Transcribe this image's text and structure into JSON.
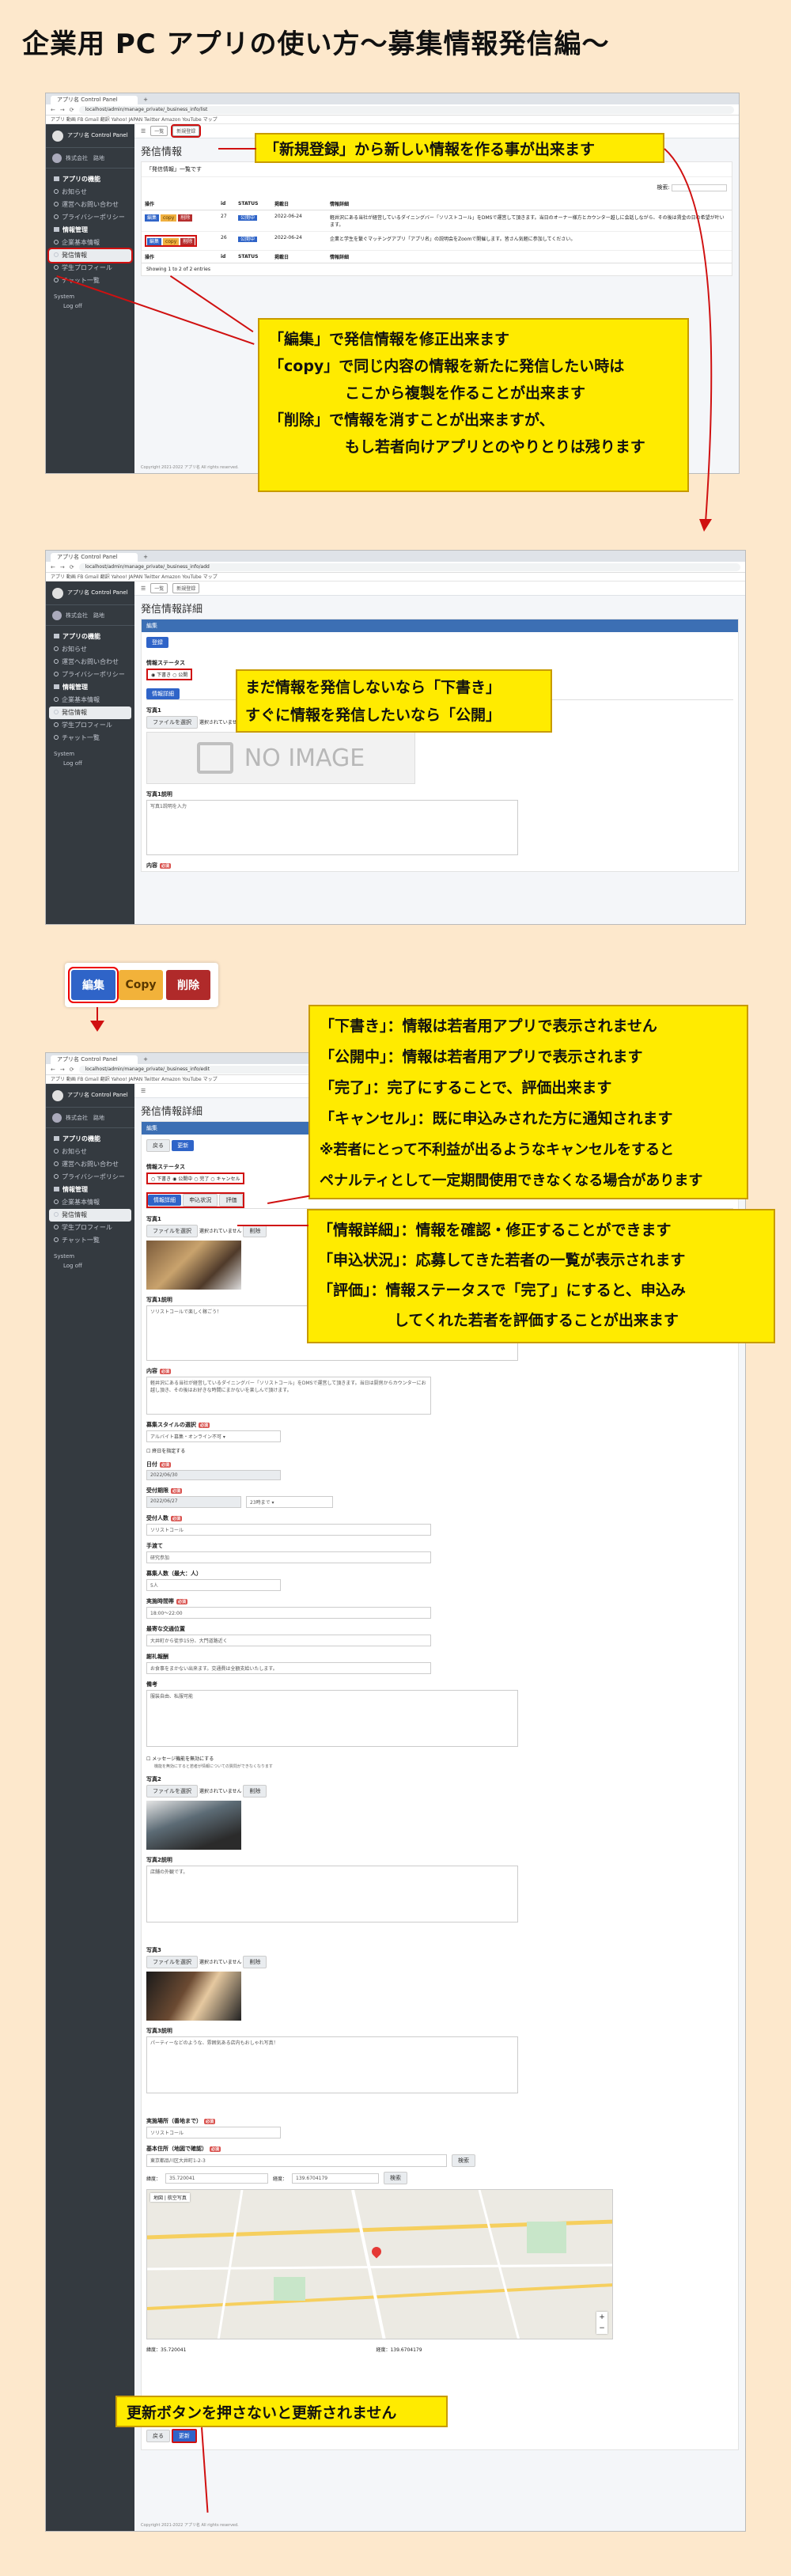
{
  "title": "企業用 PC アプリの使い方〜募集情報発信編〜",
  "browser": {
    "tab_label": "アプリ名 Control Panel",
    "url1": "localhost/admin/manage_private/_business_info/list",
    "url2": "localhost/admin/manage_private/_business_info/add",
    "url3": "localhost/admin/manage_private/_business_info/edit",
    "bookmarks": "アプリ  動画  FB  Gmail  翻訳  Yahoo! JAPAN  Twitter  Amazon  YouTube  マップ"
  },
  "sidebar": {
    "brand": "アプリ名 Control Panel",
    "company": "株式会社　路地",
    "items": [
      {
        "label": "アプリの機能",
        "type": "head"
      },
      {
        "label": "お知らせ",
        "type": "item"
      },
      {
        "label": "運営へお問い合わせ",
        "type": "item"
      },
      {
        "label": "プライバシーポリシー",
        "type": "item"
      },
      {
        "label": "情報管理",
        "type": "head"
      },
      {
        "label": "企業基本情報",
        "type": "item"
      },
      {
        "label": "発信情報",
        "type": "item",
        "active": true
      },
      {
        "label": "学生プロフィール",
        "type": "item"
      },
      {
        "label": "チャット一覧",
        "type": "item"
      }
    ],
    "system_label": "System",
    "logout": "Log off"
  },
  "screen1": {
    "nav_list": "一覧",
    "nav_new": "新規登録",
    "heading": "発信情報",
    "card_caption": "「発信情報」一覧です",
    "search_label": "検索:",
    "columns": [
      "操作",
      "id",
      "STATUS",
      "掲載日",
      "情報詳細"
    ],
    "rows": [
      {
        "id": "27",
        "status": "公開中",
        "date": "2022-06-24",
        "detail": "軽井沢にある当社が経営しているダイニングバー「ソリストコール」をDMSで運営して頂きます。当日のオーナー様方とカウンター越しに会話しながら、その後は賃金の日の希望が叶います。"
      },
      {
        "id": "26",
        "status": "公開中",
        "date": "2022-06-24",
        "detail": "企業と学生を繋ぐマッチングアプリ「アプリ名」の説明会をZoomで開催します。皆さん気軽に参加してください。"
      }
    ],
    "row_buttons": {
      "edit": "編集",
      "copy": "copy",
      "delete": "削除"
    },
    "footer_info": "Showing 1 to 2 of 2 entries",
    "copyright": "Copyright 2021-2022 アプリ名 All rights reserved."
  },
  "screen2": {
    "nav_list": "一覧",
    "nav_new": "新規登録",
    "heading": "発信情報詳細",
    "card_header": "編集",
    "save_btn": "登録",
    "status_label": "情報ステータス",
    "status_options": [
      "下書き",
      "公開"
    ],
    "tab_detail": "情報詳細",
    "image1_label": "写真1",
    "file_btn": "ファイルを選択",
    "file_none": "選択されていません",
    "delete_btn": "削除",
    "noimage": "NO IMAGE",
    "caption1_label": "写真1説明",
    "caption_placeholder": "写真1説明を入力",
    "content_label": "内容"
  },
  "big_buttons": {
    "edit": "編集",
    "copy": "Copy",
    "delete": "削除"
  },
  "screen3": {
    "heading": "発信情報詳細",
    "card_header": "編集",
    "back_btn": "戻る",
    "update_btn": "更新",
    "status_label": "情報ステータス",
    "status_options": [
      "下書き",
      "公開中",
      "完了",
      "キャンセル"
    ],
    "tabs": [
      "情報詳細",
      "申込状況",
      "評価"
    ],
    "image1_label": "写真1",
    "caption1_label": "写真1説明",
    "caption1_value": "ソリストコールで楽しく稼ごう！",
    "content_label": "内容",
    "content_value": "軽井沢にある当社が経営しているダイニングバー「ソリストコール」をDMSで運営して頂きます。当日は厨房からカウンターにお越し頂き、その後はお好きな時間にまかないを楽しんで頂けます。",
    "style_label": "募集スタイルの選択",
    "style_value": "アルバイト募集・オンライン不可",
    "all_day_label": "終日を指定する",
    "date_label": "日付",
    "date_value": "2022/06/30",
    "deadline_label": "受付期限",
    "deadline_value": "2022/06/27",
    "deadline_time": "23時まで",
    "pay_label": "受付人数",
    "pay_value": "ソリストコール",
    "hands_label": "手渡て",
    "hands_value": "研究参加",
    "people_label": "募集人数（最大：人）",
    "people_value": "5人",
    "hours_label": "実施時間帯",
    "hours_value": "18:00〜22:00",
    "transport_label": "最寄な交通位置",
    "transport_value": "大井町から徒歩15分、大門道路近く",
    "reward_label": "謝礼報酬",
    "reward_value": "お食事をまかない出来ます。交通費は全額支給いたします。",
    "notes_label": "備考",
    "notes_value": "服装自由、私服可能",
    "message_label": "メッセージ機能を無効にする",
    "message_note": "機能を無効にすると若者が情報についての質問ができなくなります",
    "image2_label": "写真2",
    "caption2_label": "写真2説明",
    "caption2_value": "店舗の外観です。",
    "image3_label": "写真3",
    "caption3_label": "写真3説明",
    "caption3_value": "パーティーなどのような、雰囲気ある店内もおしゃれ写真！",
    "place_label": "実施場所（番地まで）",
    "place_value": "ソリストコール",
    "addr_label": "基本住所（地図で確認）",
    "addr_value": "東京都品川区大井町1-2-3",
    "lat_label": "緯度：",
    "lat_value": "35.720041",
    "lng_label": "経度：",
    "lng_value": "139.6704179",
    "search_btn": "検索",
    "map_tabs": [
      "地図",
      "航空写真"
    ],
    "lat_foot": "緯度：35.720041",
    "lng_foot": "経度：139.6704179",
    "footer_back": "戻る",
    "footer_update": "更新",
    "copyright": "Copyright 2021-2022 アプリ名 All rights reserved."
  },
  "callouts": {
    "c1": "「新規登録」から新しい情報を作る事が出来ます",
    "c2": [
      "「編集」で発信情報を修正出来ます",
      "「copy」で同じ内容の情報を新たに発信したい時は",
      "ここから複製を作ることが出来ます",
      "「削除」で情報を消すことが出来ますが、",
      "もし若者向けアプリとのやりとりは残ります"
    ],
    "c3": [
      "まだ情報を発信しないなら「下書き」",
      "すぐに情報を発信したいなら「公開」"
    ],
    "c4": [
      "「下書き」：情報は若者用アプリで表示されません",
      "「公開中」：情報は若者用アプリで表示されます",
      "「完了」：完了にすることで、評価出来ます",
      "「キャンセル」：既に申込みされた方に通知されます",
      "※若者にとって不利益が出るようなキャンセルをすると",
      "ペナルティとして一定期間使用できなくなる場合があります"
    ],
    "c5": [
      "「情報詳細」：情報を確認・修正することができます",
      "「申込状況」：応募してきた若者の一覧が表示されます",
      "「評価」：情報ステータスで「完了」にすると、申込み",
      "してくれた若者を評価することが出来ます"
    ],
    "c6": "更新ボタンを押さないと更新されません"
  }
}
